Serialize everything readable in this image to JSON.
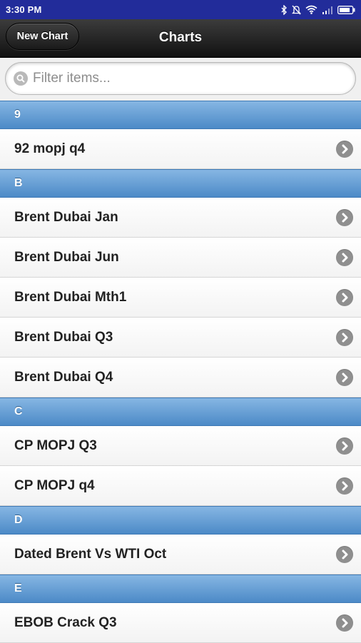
{
  "status_bar": {
    "time": "3:30 PM",
    "icons": [
      "bluetooth-icon",
      "mute-icon",
      "wifi-icon",
      "cellular-signal-icon",
      "battery-icon"
    ]
  },
  "header": {
    "title": "Charts",
    "new_chart_label": "New Chart"
  },
  "filter": {
    "placeholder": "Filter items...",
    "value": ""
  },
  "colors": {
    "status_bar": "#222c9a",
    "divider": "#5c98d2",
    "header": "#1a1a1a"
  },
  "sections": [
    {
      "header": "9",
      "items": [
        "92 mopj q4"
      ]
    },
    {
      "header": "B",
      "items": [
        "Brent Dubai Jan",
        "Brent Dubai Jun",
        "Brent Dubai Mth1",
        "Brent Dubai Q3",
        "Brent Dubai Q4"
      ]
    },
    {
      "header": "C",
      "items": [
        "CP MOPJ Q3",
        "CP MOPJ q4"
      ]
    },
    {
      "header": "D",
      "items": [
        "Dated Brent Vs WTI Oct"
      ]
    },
    {
      "header": "E",
      "items": [
        "EBOB Crack Q3"
      ]
    }
  ]
}
